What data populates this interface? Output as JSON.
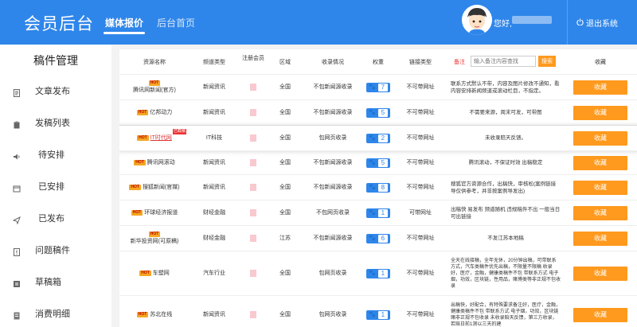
{
  "header": {
    "logo": "会员后台",
    "tabs": [
      {
        "label": "媒体报价"
      },
      {
        "label": "后台首页"
      }
    ],
    "greeting": "您好,",
    "logout": "退出系统"
  },
  "sidebar": {
    "title": "稿件管理",
    "items": [
      {
        "label": "文章发布",
        "icon": "document-icon"
      },
      {
        "label": "发稿列表",
        "icon": "clipboard-icon"
      },
      {
        "label": "待安排",
        "icon": "speaker-icon"
      },
      {
        "label": "已安排",
        "icon": "calendar-icon"
      },
      {
        "label": "已发布",
        "icon": "send-icon"
      },
      {
        "label": "问题稿件",
        "icon": "warning-icon"
      },
      {
        "label": "草稿箱",
        "icon": "draft-icon"
      },
      {
        "label": "消费明细",
        "icon": "coin-icon"
      }
    ]
  },
  "table": {
    "headers": [
      "资源名称",
      "频道类型",
      "注册会员",
      "区域",
      "收录情况",
      "权重",
      "链接类型",
      "收藏"
    ],
    "remark_label": "备注",
    "search_placeholder": "输入备注内容查找",
    "search_button": "搜索",
    "hot_label": "HOT",
    "sample_badge": "已截稿",
    "collect_label": "收藏",
    "rows": [
      {
        "name": "腾讯网新闻(官方)",
        "channel": "新闻资讯",
        "region": "全国",
        "inclusion": "不包新闻源收录",
        "weight": "7",
        "link": "不可带网址",
        "remark": "联系方式默认不带，内容及图片修改不通知，看内容安排新闻频道或滚动栏目，不指定。"
      },
      {
        "name": "亿邦动力",
        "channel": "新闻资讯",
        "region": "全国",
        "inclusion": "不包新闻源收录",
        "weight": "5",
        "link": "不可带网址",
        "remark": "不需要来源，周末可发，可带图"
      },
      {
        "name": "IT时代网",
        "channel": "IT科技",
        "region": "全国",
        "inclusion": "包网页收录",
        "weight": "2",
        "link": "不可带网址",
        "remark": "未收录赔天反馈。"
      },
      {
        "name": "腾讯网滚动",
        "channel": "新闻资讯",
        "region": "全国",
        "inclusion": "不包新闻源收录",
        "weight": "5",
        "link": "不可带网址",
        "remark": "腾讯滚动，不保证时效 出稿稳定"
      },
      {
        "name": "搜狐新闻(官媒)",
        "channel": "新闻资讯",
        "region": "全国",
        "inclusion": "不包新闻源收录",
        "weight": "8",
        "link": "不可带网址",
        "remark": "搜狐官方资源合作，出稿快，审核松(案例链接导仅供参考，并非按案例导发出)"
      },
      {
        "name": "环球经济报道",
        "channel": "财经金融",
        "region": "全国",
        "inclusion": "不包网页收录",
        "weight": "1",
        "link": "可带网址",
        "remark": "出稿快 易发布 频道随机 违规稿件不出 一般当日可出链接"
      },
      {
        "name": "新华投资网(可原稿)",
        "channel": "财经金融",
        "region": "江苏",
        "inclusion": "不包新闻源收录",
        "weight": "6",
        "link": "不可带网址",
        "remark": "不发江苏本地稿"
      },
      {
        "name": "车塑网",
        "channel": "汽车行业",
        "region": "全国",
        "inclusion": "包网页收录",
        "weight": "1",
        "link": "不可带网址",
        "remark": "全天在线接稿，全年无休，20分钟出稿，可带联系方式，汽车类稿件优先出稿，不限量不限稿 收录好，医疗，金融，健康类稿件不包 带联系方式 电子烟，功效，区块链，性用品，赌博类等非正规不包收录"
      },
      {
        "name": "苏北在线",
        "channel": "新闻资讯",
        "region": "全国",
        "inclusion": "包网页收录",
        "weight": "1",
        "link": "不可带网址",
        "remark": "出稿快，好配合，有特殊要求备注好，医疗，金融，健康类稿件不包 带联系方式 电子烟，功效，区块链赌非正规不包收录 未收录赔天反馈，第三方收录，若赔日前1测以三天的建"
      }
    ]
  },
  "colors": {
    "primary": "#2f86ea",
    "accent": "#ff9a1e",
    "hot": "#f5a623",
    "warning": "#e33333"
  }
}
